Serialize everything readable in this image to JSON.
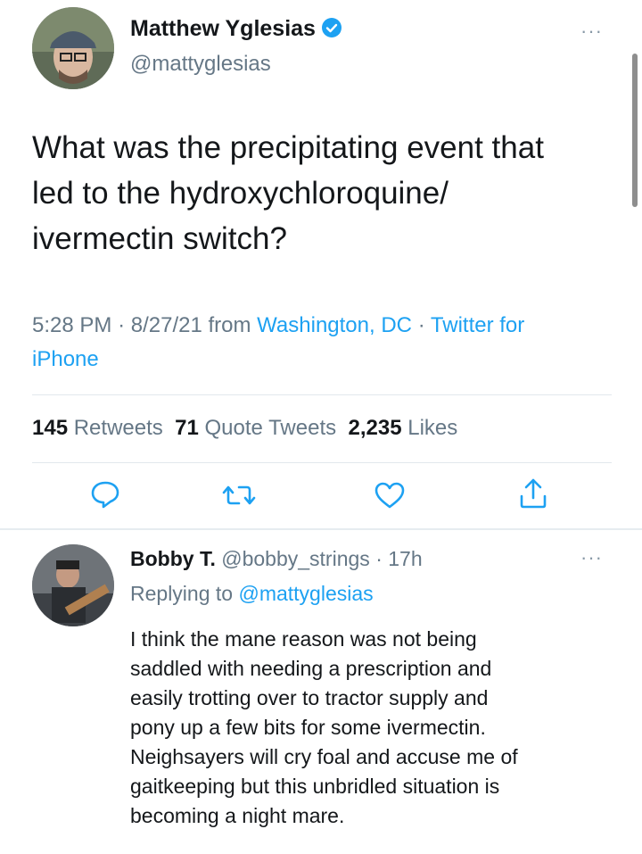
{
  "tweet": {
    "author_name": "Matthew Yglesias",
    "author_handle": "@mattyglesias",
    "more_label": "···",
    "text_lines": [
      "What was the precipitating event that",
      "led to the hydroxychloroquine/",
      "ivermectin switch?"
    ],
    "time": "5:28 PM",
    "sep": "·",
    "date": "8/27/21",
    "from_label": "from",
    "location": "Washington, DC",
    "client_line1": "Twitter for",
    "client_line2": "iPhone",
    "retweets_count": "145",
    "retweets_label": "Retweets",
    "quotes_count": "71",
    "quotes_label": "Quote Tweets",
    "likes_count": "2,235",
    "likes_label": "Likes"
  },
  "actions": {
    "reply_icon": "reply-icon",
    "retweet_icon": "retweet-icon",
    "like_icon": "heart-icon",
    "share_icon": "share-icon",
    "color": "#1da1f2"
  },
  "reply": {
    "author_name": "Bobby T.",
    "author_handle": "@bobby_strings",
    "sep": "·",
    "age": "17h",
    "more_label": "···",
    "replying_prefix": "Replying to",
    "replying_to": "@mattyglesias",
    "text_lines": [
      "I think the mane reason was not being",
      "saddled with needing a prescription and",
      "easily trotting over to tractor supply and",
      "pony up a few bits for some ivermectin.",
      "Neighsayers will cry foal and accuse me of",
      "gaitkeeping but this unbridled situation is",
      "becoming a night mare."
    ]
  }
}
